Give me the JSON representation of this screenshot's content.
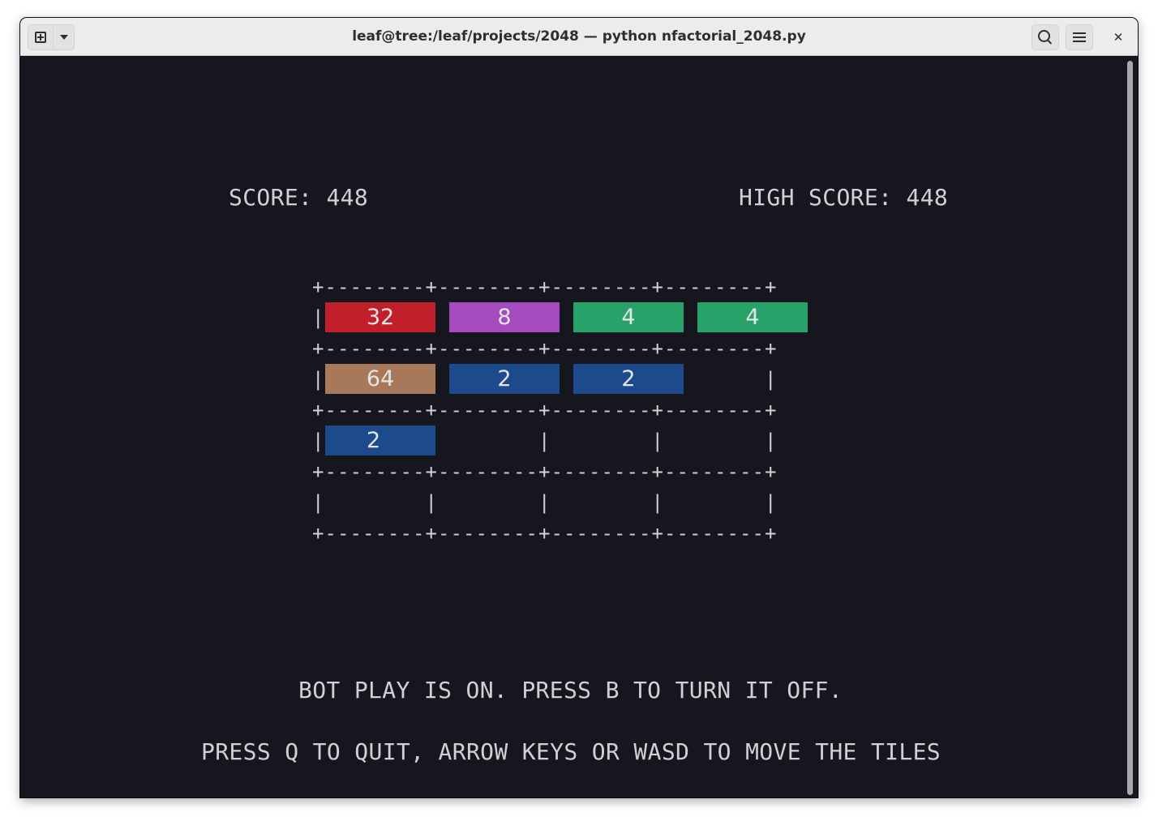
{
  "window": {
    "title": "leaf@tree:/leaf/projects/2048 — python nfactorial_2048.py"
  },
  "titlebar": {
    "close_glyph": "✕",
    "icons": {
      "new_tab": "new-tab-icon",
      "dropdown": "chevron-down-icon",
      "search": "search-icon",
      "menu": "hamburger-menu-icon",
      "close": "close-icon"
    }
  },
  "game": {
    "score_text": "SCORE: 448",
    "high_score_text": "HIGH SCORE: 448",
    "board": {
      "separator_line": "+--------+--------+--------+--------+",
      "row_line": "|        |        |        |        |",
      "rows": [
        [
          {
            "value": "32",
            "color": "#c11f2a"
          },
          {
            "value": "8",
            "color": "#a44cbf"
          },
          {
            "value": "4",
            "color": "#27a36a"
          },
          {
            "value": "4",
            "color": "#27a36a"
          }
        ],
        [
          {
            "value": "64",
            "color": "#a8785a"
          },
          {
            "value": "2",
            "color": "#1c4a8c"
          },
          {
            "value": "2",
            "color": "#1c4a8c"
          },
          null
        ],
        [
          {
            "value": "2",
            "color": "#1c4a8c"
          },
          null,
          null,
          null
        ],
        [
          null,
          null,
          null,
          null
        ]
      ]
    },
    "bot_message": "BOT PLAY IS ON. PRESS B TO TURN IT OFF.",
    "help_message": "PRESS Q TO QUIT, ARROW KEYS OR WASD TO MOVE THE TILES"
  },
  "colors": {
    "terminal_bg": "#16161e",
    "terminal_fg": "#d0d0d6",
    "titlebar_bg": "#ececec"
  }
}
